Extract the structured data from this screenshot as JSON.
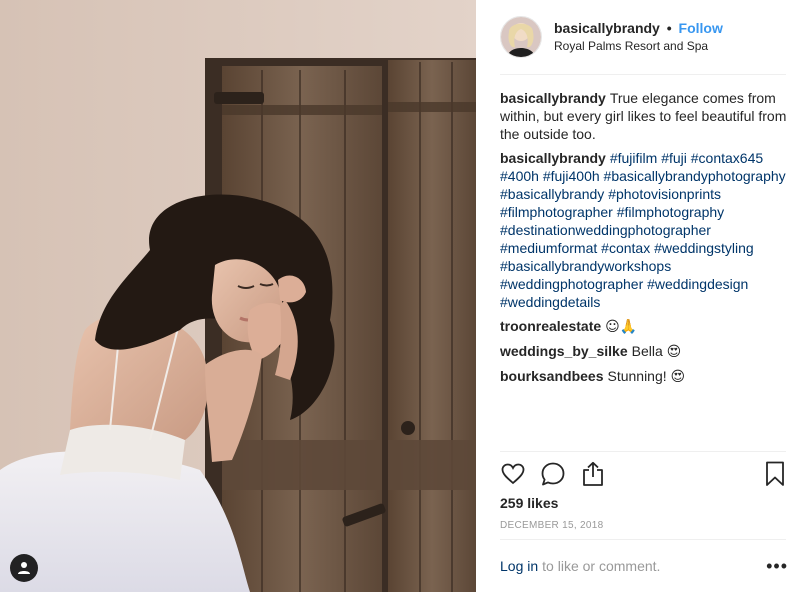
{
  "post": {
    "author": "basicallybrandy",
    "separator": "•",
    "follow_label": "Follow",
    "location": "Royal Palms Resort and Spa",
    "caption": {
      "author": "basicallybrandy",
      "text": "True elegance comes from within, but every girl likes to feel beautiful from the outside too."
    },
    "tags_comment": {
      "author": "basicallybrandy",
      "hashtags": [
        "#fujifilm",
        "#fuji",
        "#contax645",
        "#400h",
        "#fuji400h",
        "#basicallybrandyphotography",
        "#basicallybrandy",
        "#photovisionprints",
        "#filmphotographer",
        "#filmphotography",
        "#destinationweddingphotographer",
        "#mediumformat",
        "#contax",
        "#weddingstyling",
        "#basicallybrandyworkshops",
        "#weddingphotographer",
        "#weddingdesign",
        "#weddingdetails"
      ]
    },
    "comments": [
      {
        "author": "troonrealestate",
        "text": "",
        "emoji": "☺🙏"
      },
      {
        "author": "weddings_by_silke",
        "text": "Bella",
        "emoji": "😍"
      },
      {
        "author": "bourksandbees",
        "text": "Stunning!",
        "emoji": "😍"
      }
    ],
    "likes": "259 likes",
    "date": "DECEMBER 15, 2018",
    "footer": {
      "login_label": "Log in",
      "login_suffix": "to like or comment.",
      "more_label": "•••"
    }
  },
  "icons": {
    "like": "heart-icon",
    "comment": "speech-bubble-icon",
    "share": "share-icon",
    "save": "bookmark-icon",
    "user_tags": "user-icon"
  },
  "colors": {
    "link_blue": "#3897f0",
    "hashtag_navy": "#003569",
    "muted_gray": "#999999",
    "text_dark": "#262626",
    "divider": "#efefef"
  }
}
